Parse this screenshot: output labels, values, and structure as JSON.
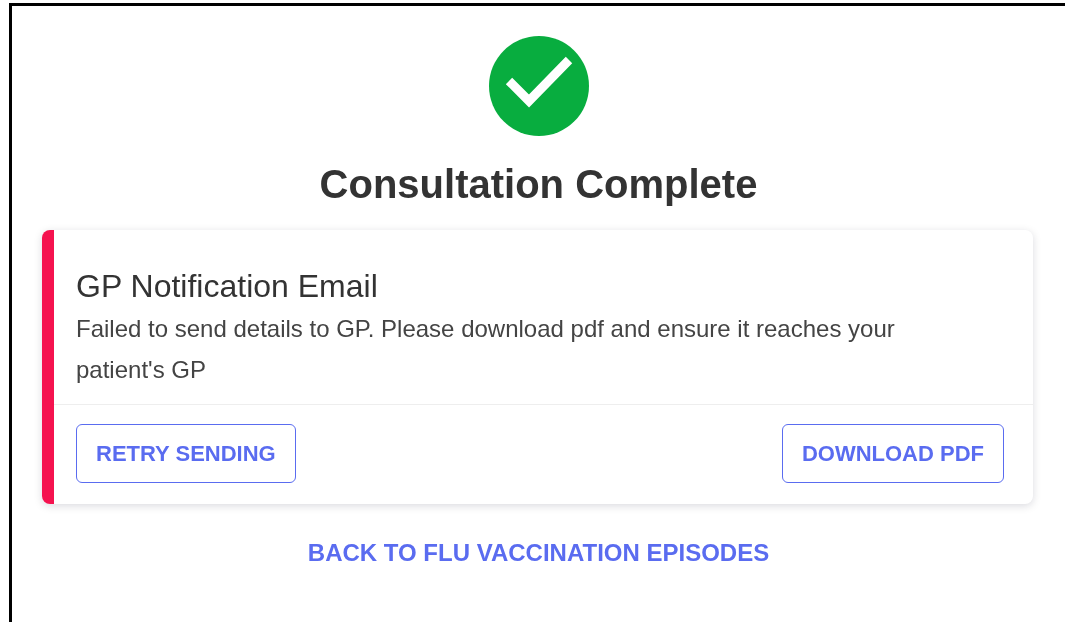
{
  "heading": "Consultation Complete",
  "notice": {
    "error": true,
    "title": "GP Notification Email",
    "message": "Failed to send details to GP. Please download pdf and ensure it reaches your patient's GP",
    "buttons": [
      "RETRY SENDING",
      "DOWNLOAD PDF"
    ]
  },
  "back_link": "BACK TO FLU VACCINATION EPISODES"
}
